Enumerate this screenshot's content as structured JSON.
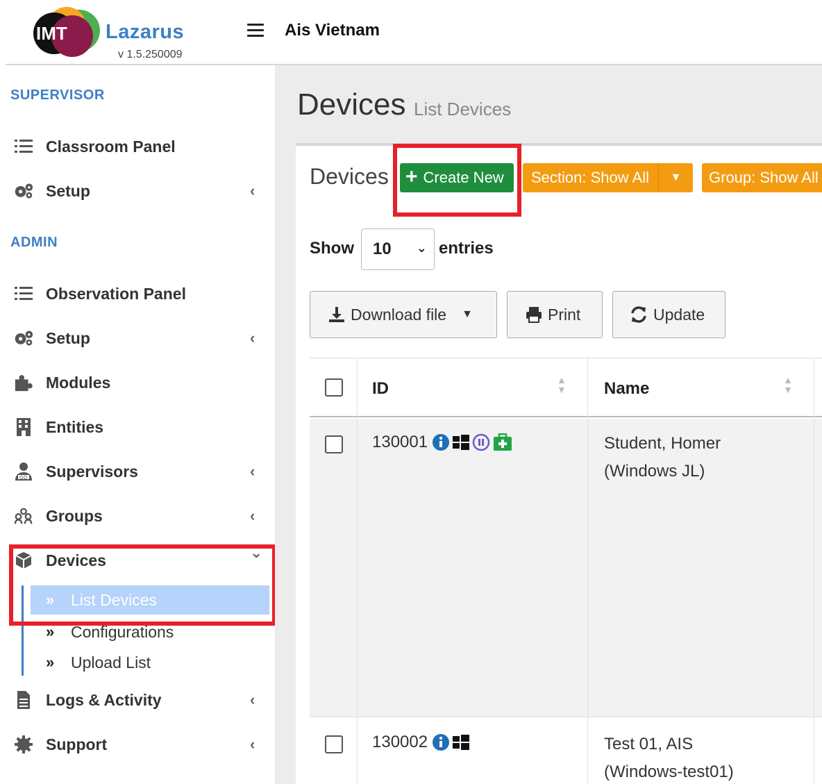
{
  "header": {
    "logo_letters": "IMT",
    "app_name": "Lazarus",
    "version": "v 1.5.250009",
    "org_name": "Ais Vietnam"
  },
  "sidebar": {
    "supervisor_label": "SUPERVISOR",
    "admin_label": "ADMIN",
    "supervisor_items": [
      {
        "label": "Classroom Panel",
        "icon": "list-icon"
      },
      {
        "label": "Setup",
        "icon": "cogs-icon",
        "chevron": "‹"
      }
    ],
    "admin_items": [
      {
        "label": "Observation Panel",
        "icon": "list-icon"
      },
      {
        "label": "Setup",
        "icon": "cogs-icon",
        "chevron": "‹"
      },
      {
        "label": "Modules",
        "icon": "puzzle-icon"
      },
      {
        "label": "Entities",
        "icon": "building-icon"
      },
      {
        "label": "Supervisors",
        "icon": "user-tie-icon",
        "chevron": "‹"
      },
      {
        "label": "Groups",
        "icon": "users-icon",
        "chevron": "‹"
      },
      {
        "label": "Devices",
        "icon": "cube-icon",
        "chevron": "⌄"
      },
      {
        "label": "Logs & Activity",
        "icon": "file-icon",
        "chevron": "‹"
      },
      {
        "label": "Support",
        "icon": "gear-icon",
        "chevron": "‹"
      }
    ],
    "devices_sub": [
      {
        "label": "List Devices",
        "active": true
      },
      {
        "label": "Configurations"
      },
      {
        "label": "Upload List"
      }
    ]
  },
  "page": {
    "title": "Devices",
    "subtitle": "List Devices"
  },
  "box": {
    "title": "Devices",
    "create_label": "Create New",
    "section_filter": "Section: Show All",
    "group_filter": "Group: Show All"
  },
  "table_controls": {
    "show_label": "Show",
    "entries_value": "10",
    "entries_label": "entries",
    "download_label": "Download file",
    "print_label": "Print",
    "update_label": "Update"
  },
  "table": {
    "columns": [
      "ID",
      "Name"
    ],
    "rows": [
      {
        "id": "130001",
        "name_line1": "Student, Homer",
        "name_line2": "(Windows JL)",
        "icons": [
          "info-icon",
          "windows-icon",
          "pause-icon",
          "medkit-icon"
        ]
      },
      {
        "id": "130002",
        "name_line1": "Test 01, AIS",
        "name_line2": "(Windows-test01)",
        "icons": [
          "info-icon",
          "windows-icon"
        ]
      }
    ]
  },
  "colors": {
    "brand_blue": "#3d7fc6",
    "create_green": "#1e8e3e",
    "filter_orange": "#f39c12",
    "highlight_red": "#e8202a",
    "active_submenu": "#b5d3fb"
  }
}
